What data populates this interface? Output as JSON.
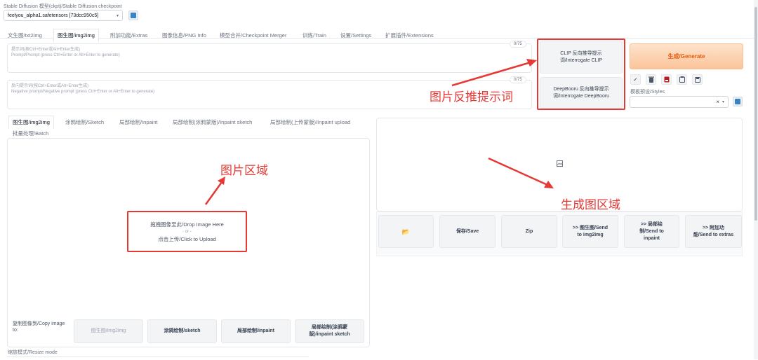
{
  "checkpoint": {
    "label": "Stable Diffusion 模型(ckpt)/Stable Diffusion checkpoint",
    "value": "feelyou_alpha1.safetensors [73dcc950c5]"
  },
  "tabs": [
    "文生图/txt2img",
    "图生图/img2img",
    "附加功能/Extras",
    "图像信息/PNG Info",
    "模型合并/Checkpoint Merger",
    "训练/Train",
    "设置/Settings",
    "扩展插件/Extensions"
  ],
  "prompt": {
    "placeholder_line1": "提示词(按Ctrl+Enter或Alt+Enter生成)",
    "placeholder_line2": "Prompt/Prompt (press Ctrl+Enter or Alt+Enter to generate)",
    "counter": "0/75"
  },
  "negative_prompt": {
    "placeholder_line1": "反向提示词(按Ctrl+Enter或Alt+Enter生成)",
    "placeholder_line2": "Negative prompt/Negative prompt (press Ctrl+Enter or Alt+Enter to generate)",
    "counter": "0/75"
  },
  "interrogate": {
    "clip_line1": "CLIP 反向推导提示",
    "clip_line2": "词/Interrogate CLIP",
    "deepbooru_line1": "DeepBooru 反向推导提示",
    "deepbooru_line2": "词/Interrogate DeepBooru"
  },
  "generate_label": "生成/Generate",
  "styles": {
    "label": "模板预设/Styles",
    "clear": "×",
    "chevron": "▾"
  },
  "tool_icons": [
    "check-icon",
    "trash-icon",
    "red-card-icon",
    "clipboard-icon",
    "save-icon"
  ],
  "sub_tabs": [
    "图生图/img2img",
    "涂鸦绘制/Sketch",
    "局部绘制/Inpaint",
    "局部绘制(涂鸦蒙版)/Inpaint sketch",
    "局部绘制(上传蒙版)/Inpaint upload"
  ],
  "batch_tab": "批量处理/Batch",
  "dropzone": {
    "line1": "拖拽图像至此/Drop Image Here",
    "line2": "- or -",
    "line3": "点击上传/Click to Upload"
  },
  "copy_image_to": {
    "label_line1": "复制图像到/Copy image",
    "label_line2": "to:",
    "btn_img2img": "图生图/img2img",
    "btn_sketch": "涂鸦绘制/sketch",
    "btn_inpaint": "局部绘制/inpaint",
    "btn_inpaint_sketch_line1": "局部绘制(涂鸦蒙",
    "btn_inpaint_sketch_line2": "版)/inpaint sketch"
  },
  "resize_mode_label": "缩放模式/Resize mode",
  "output_buttons": {
    "folder": "📂",
    "save": "保存/Save",
    "zip": "Zip",
    "send_img2img_line1": ">> 图生图/Send",
    "send_img2img_line2": "to img2img",
    "send_inpaint_line1": ">> 局部绘",
    "send_inpaint_line2": "制/Send to",
    "send_inpaint_line3": "inpaint",
    "send_extras_line1": ">> 附加功",
    "send_extras_line2": "能/Send to extras"
  },
  "annotations": {
    "interrogate_note": "图片反推提示词",
    "image_area_note": "图片区域",
    "output_area_note": "生成图区域"
  },
  "colors": {
    "accent_red": "#e53935",
    "generate_orange": "#ea580c",
    "refresh_blue": "#3b82c4"
  }
}
